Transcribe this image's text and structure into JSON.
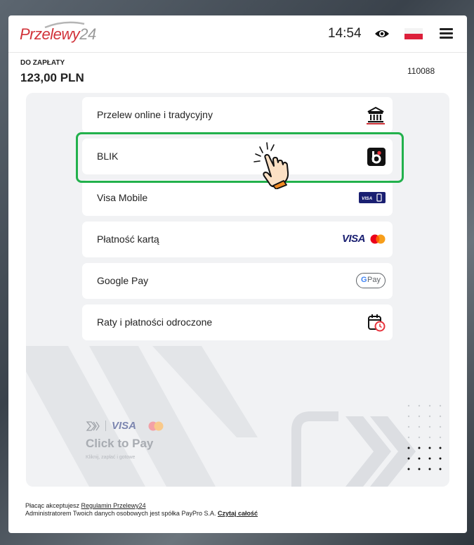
{
  "header": {
    "logo_text_main": "Przelewy",
    "logo_text_num": "24",
    "time": "14:54",
    "icons": [
      "eye-icon",
      "polish-flag-icon",
      "hamburger-menu-icon"
    ]
  },
  "payment": {
    "label": "DO ZAPŁATY",
    "amount": "123,00 PLN",
    "order_id": "110088"
  },
  "methods": [
    {
      "label": "Przelew online i tradycyjny",
      "icon": "bank-icon"
    },
    {
      "label": "BLIK",
      "icon": "blik-icon"
    },
    {
      "label": "Visa Mobile",
      "icon": "visa-mobile-icon"
    },
    {
      "label": "Płatność kartą",
      "icon": "visa-mastercard-icon"
    },
    {
      "label": "Google Pay",
      "icon": "google-pay-icon"
    },
    {
      "label": "Raty i płatności odroczone",
      "icon": "calendar-clock-icon"
    }
  ],
  "badges": {
    "visa_mobile": "VISA",
    "card_visa": "VISA",
    "gpay_g": "G",
    "gpay_pay": "Pay"
  },
  "click_to_pay": {
    "visa": "VISA",
    "title": "Click to Pay",
    "subtitle": "Kliknij, zapłać i gotowe"
  },
  "footer": {
    "line1_prefix": "Płacąc akceptujesz ",
    "line1_link": "Regulamin Przelewy24",
    "line2_prefix": "Administratorem Twoich danych osobowych jest spółka PayPro S.A. ",
    "line2_link": "Czytaj całość"
  },
  "colors": {
    "brand_red": "#d13239",
    "highlight_green": "#22b14c",
    "visa_blue": "#1a1f71",
    "panel_bg": "#f1f2f4"
  }
}
